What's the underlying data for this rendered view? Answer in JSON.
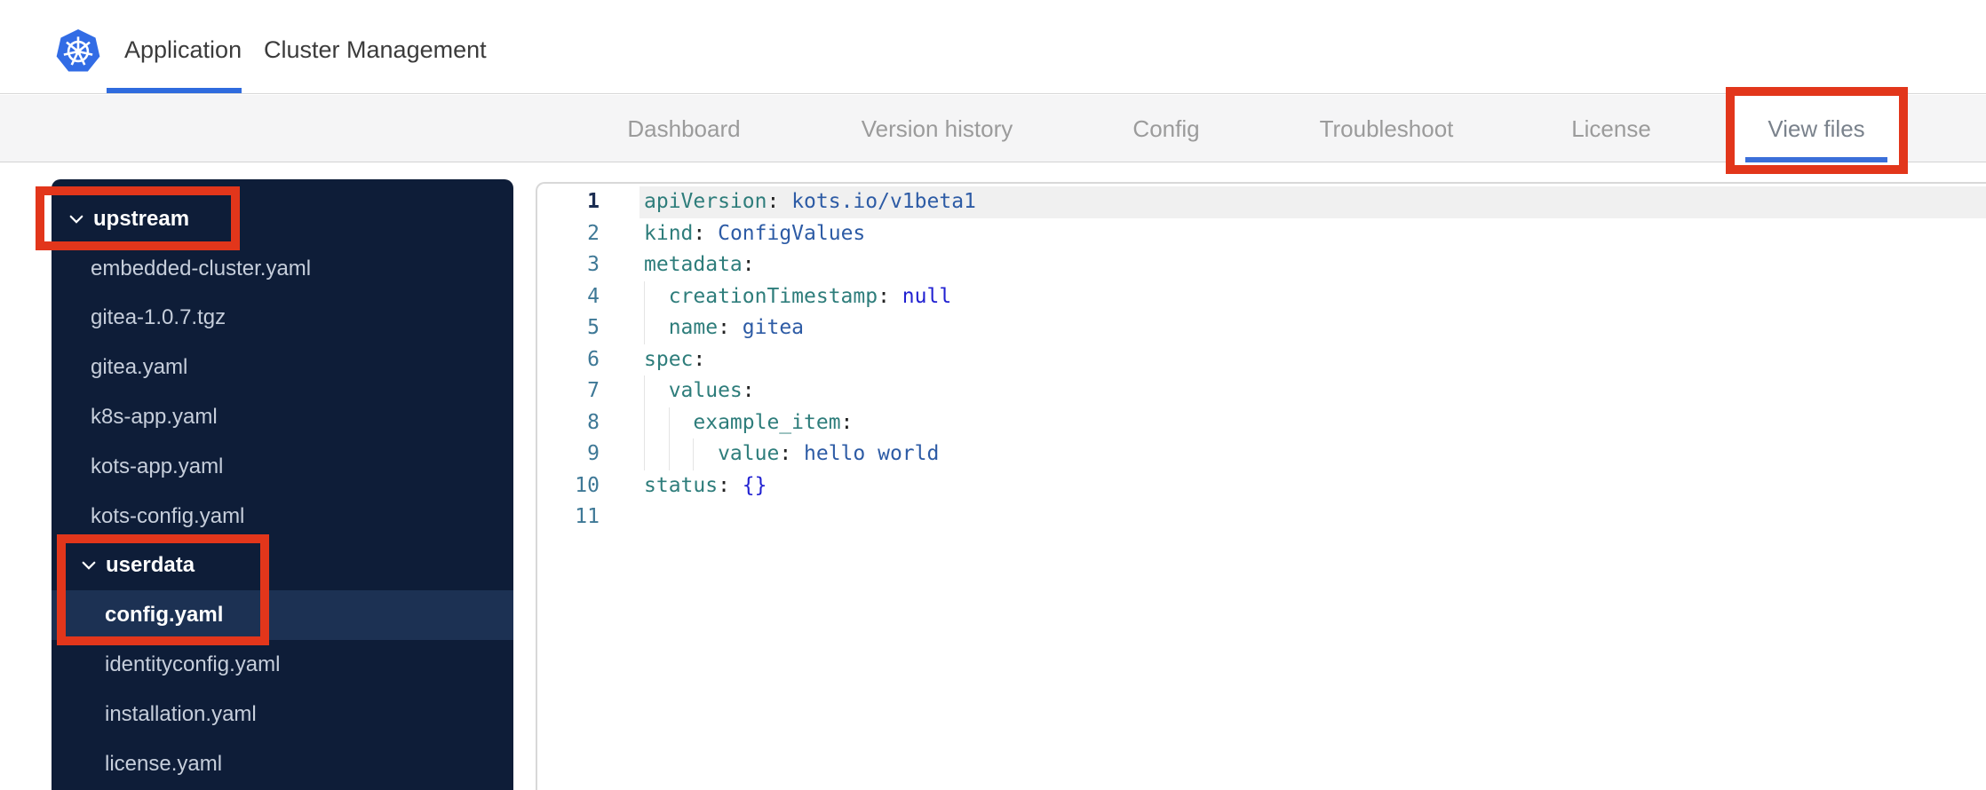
{
  "header": {
    "logo": "kubernetes-logo",
    "tabs": [
      {
        "label": "Application",
        "active": true
      },
      {
        "label": "Cluster Management",
        "active": false
      }
    ]
  },
  "subnav": {
    "items": [
      {
        "label": "Dashboard",
        "active": false
      },
      {
        "label": "Version history",
        "active": false
      },
      {
        "label": "Config",
        "active": false
      },
      {
        "label": "Troubleshoot",
        "active": false
      },
      {
        "label": "License",
        "active": false
      },
      {
        "label": "View files",
        "active": true
      }
    ]
  },
  "file_tree": {
    "items": [
      {
        "type": "folder",
        "label": "upstream",
        "level": 0,
        "expanded": true,
        "selected": false
      },
      {
        "type": "file",
        "label": "embedded-cluster.yaml",
        "level": 1,
        "selected": false
      },
      {
        "type": "file",
        "label": "gitea-1.0.7.tgz",
        "level": 1,
        "selected": false
      },
      {
        "type": "file",
        "label": "gitea.yaml",
        "level": 1,
        "selected": false
      },
      {
        "type": "file",
        "label": "k8s-app.yaml",
        "level": 1,
        "selected": false
      },
      {
        "type": "file",
        "label": "kots-app.yaml",
        "level": 1,
        "selected": false
      },
      {
        "type": "file",
        "label": "kots-config.yaml",
        "level": 1,
        "selected": false
      },
      {
        "type": "folder",
        "label": "userdata",
        "level": 1,
        "expanded": true,
        "selected": false
      },
      {
        "type": "file",
        "label": "config.yaml",
        "level": 2,
        "selected": true
      },
      {
        "type": "file",
        "label": "identityconfig.yaml",
        "level": 2,
        "selected": false
      },
      {
        "type": "file",
        "label": "installation.yaml",
        "level": 2,
        "selected": false
      },
      {
        "type": "file",
        "label": "license.yaml",
        "level": 2,
        "selected": false
      }
    ]
  },
  "editor": {
    "lines": [
      {
        "num": "1",
        "active": true,
        "guides": 0,
        "tokens": [
          {
            "t": "key",
            "v": "apiVersion"
          },
          {
            "t": "p",
            "v": ": "
          },
          {
            "t": "str",
            "v": "kots.io/v1beta1"
          }
        ]
      },
      {
        "num": "2",
        "active": false,
        "guides": 0,
        "tokens": [
          {
            "t": "key",
            "v": "kind"
          },
          {
            "t": "p",
            "v": ": "
          },
          {
            "t": "str",
            "v": "ConfigValues"
          }
        ]
      },
      {
        "num": "3",
        "active": false,
        "guides": 0,
        "tokens": [
          {
            "t": "key",
            "v": "metadata"
          },
          {
            "t": "p",
            "v": ":"
          }
        ]
      },
      {
        "num": "4",
        "active": false,
        "guides": 1,
        "tokens": [
          {
            "t": "key",
            "v": "creationTimestamp"
          },
          {
            "t": "p",
            "v": ": "
          },
          {
            "t": "kw",
            "v": "null"
          }
        ]
      },
      {
        "num": "5",
        "active": false,
        "guides": 1,
        "tokens": [
          {
            "t": "key",
            "v": "name"
          },
          {
            "t": "p",
            "v": ": "
          },
          {
            "t": "str",
            "v": "gitea"
          }
        ]
      },
      {
        "num": "6",
        "active": false,
        "guides": 0,
        "tokens": [
          {
            "t": "key",
            "v": "spec"
          },
          {
            "t": "p",
            "v": ":"
          }
        ]
      },
      {
        "num": "7",
        "active": false,
        "guides": 1,
        "tokens": [
          {
            "t": "key",
            "v": "values"
          },
          {
            "t": "p",
            "v": ":"
          }
        ]
      },
      {
        "num": "8",
        "active": false,
        "guides": 2,
        "tokens": [
          {
            "t": "key",
            "v": "example_item"
          },
          {
            "t": "p",
            "v": ":"
          }
        ]
      },
      {
        "num": "9",
        "active": false,
        "guides": 3,
        "tokens": [
          {
            "t": "key",
            "v": "value"
          },
          {
            "t": "p",
            "v": ": "
          },
          {
            "t": "str",
            "v": "hello world"
          }
        ]
      },
      {
        "num": "10",
        "active": false,
        "guides": 0,
        "tokens": [
          {
            "t": "key",
            "v": "status"
          },
          {
            "t": "p",
            "v": ": "
          },
          {
            "t": "kw",
            "v": "{}"
          }
        ]
      },
      {
        "num": "11",
        "active": false,
        "guides": 0,
        "tokens": []
      }
    ]
  },
  "annotations": {
    "color": "#e2361b",
    "boxes": [
      "upstream-folder",
      "userdata-and-config-yaml",
      "view-files-tab"
    ]
  },
  "colors": {
    "brand_blue": "#326ce5",
    "tab_underline": "#3b6fd9",
    "sidebar_bg": "#0e1d38",
    "sidebar_selected_bg": "#1c3153",
    "yaml_key": "#2e7d7b",
    "yaml_value": "#2d5ba5",
    "yaml_keyword": "#2121d1",
    "line_number": "#3e7896"
  }
}
